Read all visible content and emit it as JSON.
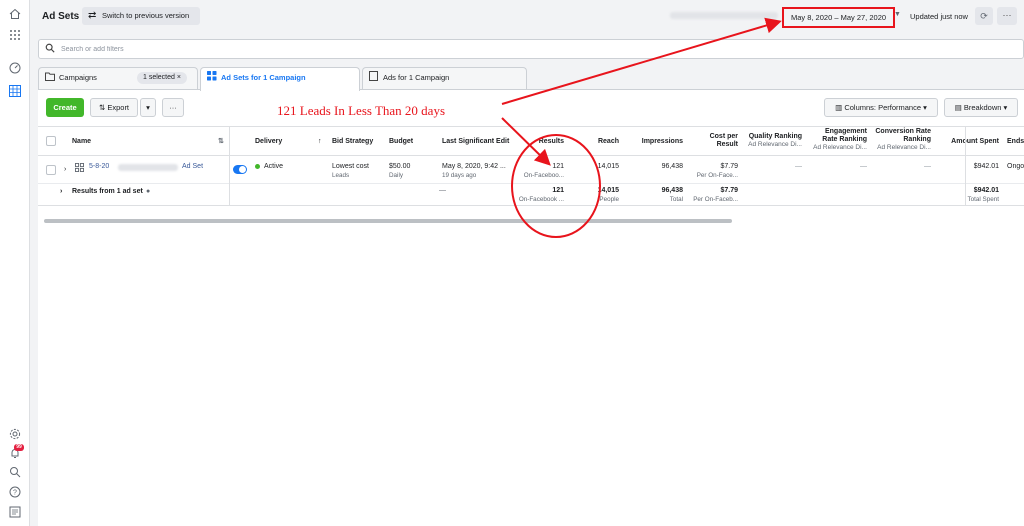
{
  "rail": {
    "icons": [
      "home-icon",
      "apps-grid-icon",
      "dashboard-icon",
      "ads-manager-icon",
      "settings-icon",
      "notifications-icon",
      "search-icon",
      "help-icon",
      "report-icon"
    ],
    "notification_badge": "99"
  },
  "topbar": {
    "title": "Ad Sets",
    "switch_label": "Switch to previous version",
    "date_range": "May 8, 2020 – May 27, 2020",
    "updated": "Updated just now",
    "more": "···"
  },
  "search": {
    "placeholder": "Search or add filters"
  },
  "tabs": [
    {
      "label": "Campaigns",
      "chip": "1 selected ×"
    },
    {
      "label": "Ad Sets for 1 Campaign"
    },
    {
      "label": "Ads for 1 Campaign"
    }
  ],
  "toolbar": {
    "create": "Create",
    "export": "Export",
    "columns": "Columns: Performance",
    "breakdown": "Breakdown"
  },
  "annotation": {
    "text": "121 Leads In Less Than 20 days"
  },
  "table": {
    "headers": {
      "name": "Name",
      "delivery": "Delivery",
      "bid_strategy": "Bid Strategy",
      "budget": "Budget",
      "last_edit": "Last Significant Edit",
      "results": "Results",
      "reach": "Reach",
      "impressions": "Impressions",
      "cost_per_result_1": "Cost per",
      "cost_per_result_2": "Result",
      "quality_ranking": "Quality Ranking",
      "quality_sub": "Ad Relevance Di...",
      "engagement_1": "Engagement",
      "engagement_2": "Rate Ranking",
      "engagement_sub": "Ad Relevance Di...",
      "conversion_1": "Conversion Rate",
      "conversion_2": "Ranking",
      "conversion_sub": "Ad Relevance Di...",
      "amount_spent": "Amount Spent",
      "ends": "Ends"
    },
    "row": {
      "name": "5-8-20",
      "type": "Ad Set",
      "delivery": "Active",
      "bid_strategy": "Lowest cost",
      "bid_sub": "Leads",
      "budget": "$50.00",
      "budget_sub": "Daily",
      "last_edit": "May 8, 2020, 9:42 ...",
      "last_edit_sub": "19 days ago",
      "results": "121",
      "results_sub": "On-Faceboo...",
      "reach": "14,015",
      "impressions": "96,438",
      "cost_per_result": "$7.79",
      "cost_sub": "Per On-Face...",
      "quality": "—",
      "engagement": "—",
      "conversion": "—",
      "amount_spent": "$942.01",
      "ends": "Ongo"
    },
    "summary": {
      "label": "Results from 1 ad set",
      "last_edit": "—",
      "results": "121",
      "results_sub": "On-Facebook ...",
      "reach": "14,015",
      "reach_sub": "People",
      "impressions": "96,438",
      "impressions_sub": "Total",
      "cost_per_result": "$7.79",
      "cost_sub": "Per On-Faceb...",
      "amount_spent": "$942.01",
      "amount_sub": "Total Spent"
    }
  }
}
